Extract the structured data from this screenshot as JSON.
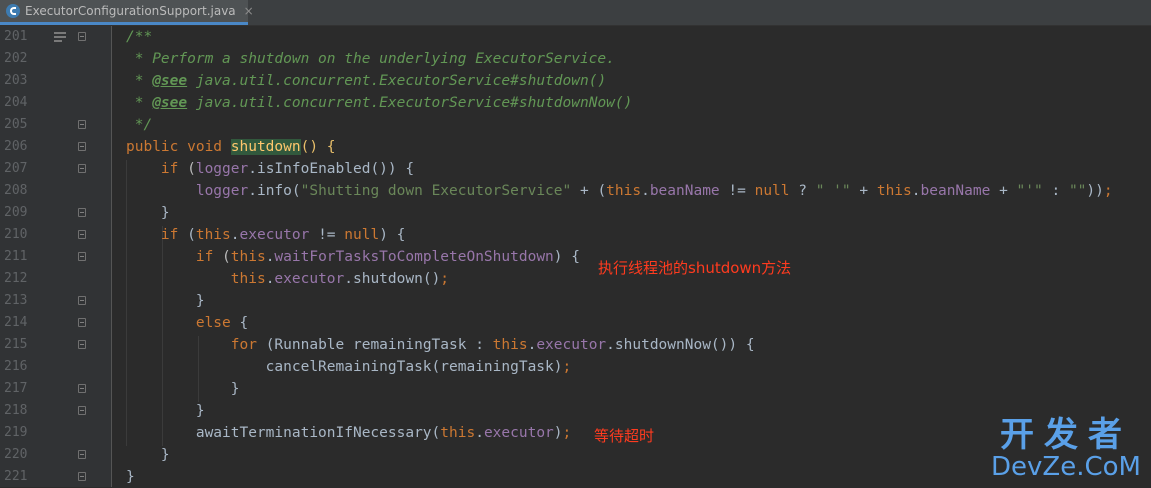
{
  "tab": {
    "filename": "ExecutorConfigurationSupport.java",
    "close_glyph": "×"
  },
  "lines": [
    {
      "n": "201",
      "tokens": [
        {
          "t": "/**",
          "c": "cm"
        }
      ]
    },
    {
      "n": "202",
      "tokens": [
        {
          "t": " * Perform a shutdown on the underlying ExecutorService.",
          "c": "cm"
        }
      ]
    },
    {
      "n": "203",
      "tokens": [
        {
          "t": " * ",
          "c": "cm"
        },
        {
          "t": "@see",
          "c": "tag"
        },
        {
          "t": " java.util.concurrent.ExecutorService",
          "c": "cm"
        },
        {
          "t": "#shutdown()",
          "c": "cm"
        }
      ]
    },
    {
      "n": "204",
      "tokens": [
        {
          "t": " * ",
          "c": "cm"
        },
        {
          "t": "@see",
          "c": "tag"
        },
        {
          "t": " java.util.concurrent.ExecutorService",
          "c": "cm"
        },
        {
          "t": "#shutdownNow()",
          "c": "cm"
        }
      ]
    },
    {
      "n": "205",
      "tokens": [
        {
          "t": " */",
          "c": "cm"
        }
      ]
    },
    {
      "n": "206",
      "tokens": [
        {
          "t": "public void ",
          "c": "kw"
        },
        {
          "t": "shutdown",
          "c": "hl"
        },
        {
          "t": "() {",
          "c": "pr"
        }
      ]
    },
    {
      "n": "207",
      "tokens": [
        {
          "t": "    if ",
          "c": "kw"
        },
        {
          "t": "(",
          "c": "pg"
        },
        {
          "t": "logger",
          "c": "fld"
        },
        {
          "t": ".isInfoEnabled()) {",
          "c": ""
        }
      ]
    },
    {
      "n": "208",
      "tokens": [
        {
          "t": "        ",
          "c": ""
        },
        {
          "t": "logger",
          "c": "fld"
        },
        {
          "t": ".info(",
          "c": ""
        },
        {
          "t": "\"Shutting down ExecutorService\"",
          "c": "str"
        },
        {
          "t": " + (",
          "c": ""
        },
        {
          "t": "this",
          "c": "kw"
        },
        {
          "t": ".",
          "c": ""
        },
        {
          "t": "beanName",
          "c": "fld"
        },
        {
          "t": " != ",
          "c": ""
        },
        {
          "t": "null",
          "c": "kw"
        },
        {
          "t": " ? ",
          "c": ""
        },
        {
          "t": "\" '\"",
          "c": "str"
        },
        {
          "t": " + ",
          "c": ""
        },
        {
          "t": "this",
          "c": "kw"
        },
        {
          "t": ".",
          "c": ""
        },
        {
          "t": "beanName",
          "c": "fld"
        },
        {
          "t": " + ",
          "c": ""
        },
        {
          "t": "\"'\"",
          "c": "str"
        },
        {
          "t": " : ",
          "c": ""
        },
        {
          "t": "\"\"",
          "c": "str"
        },
        {
          "t": "))",
          "c": ""
        },
        {
          "t": ";",
          "c": "kw"
        }
      ]
    },
    {
      "n": "209",
      "tokens": [
        {
          "t": "    }",
          "c": ""
        }
      ]
    },
    {
      "n": "210",
      "tokens": [
        {
          "t": "    if ",
          "c": "kw"
        },
        {
          "t": "(",
          "c": ""
        },
        {
          "t": "this",
          "c": "kw"
        },
        {
          "t": ".",
          "c": ""
        },
        {
          "t": "executor",
          "c": "fld"
        },
        {
          "t": " != ",
          "c": ""
        },
        {
          "t": "null",
          "c": "kw"
        },
        {
          "t": ") {",
          "c": ""
        }
      ]
    },
    {
      "n": "211",
      "tokens": [
        {
          "t": "        if ",
          "c": "kw"
        },
        {
          "t": "(",
          "c": "pg"
        },
        {
          "t": "this",
          "c": "kw"
        },
        {
          "t": ".",
          "c": ""
        },
        {
          "t": "waitForTasksToCompleteOnShutdown",
          "c": "fld"
        },
        {
          "t": ") {",
          "c": ""
        }
      ]
    },
    {
      "n": "212",
      "tokens": [
        {
          "t": "            ",
          "c": ""
        },
        {
          "t": "this",
          "c": "kw"
        },
        {
          "t": ".",
          "c": ""
        },
        {
          "t": "executor",
          "c": "fld"
        },
        {
          "t": ".shutdown()",
          "c": ""
        },
        {
          "t": ";",
          "c": "kw"
        }
      ]
    },
    {
      "n": "213",
      "tokens": [
        {
          "t": "        }",
          "c": ""
        }
      ]
    },
    {
      "n": "214",
      "tokens": [
        {
          "t": "        else ",
          "c": "kw"
        },
        {
          "t": "{",
          "c": ""
        }
      ]
    },
    {
      "n": "215",
      "tokens": [
        {
          "t": "            for ",
          "c": "kw"
        },
        {
          "t": "(Runnable remainingTask : ",
          "c": ""
        },
        {
          "t": "this",
          "c": "kw"
        },
        {
          "t": ".",
          "c": ""
        },
        {
          "t": "executor",
          "c": "fld"
        },
        {
          "t": ".shutdownNow()) {",
          "c": ""
        }
      ]
    },
    {
      "n": "216",
      "tokens": [
        {
          "t": "                cancelRemainingTask(remainingTask)",
          "c": ""
        },
        {
          "t": ";",
          "c": "kw"
        }
      ]
    },
    {
      "n": "217",
      "tokens": [
        {
          "t": "            }",
          "c": ""
        }
      ]
    },
    {
      "n": "218",
      "tokens": [
        {
          "t": "        }",
          "c": ""
        }
      ]
    },
    {
      "n": "219",
      "tokens": [
        {
          "t": "        awaitTerminationIfNecessary(",
          "c": ""
        },
        {
          "t": "this",
          "c": "kw"
        },
        {
          "t": ".",
          "c": ""
        },
        {
          "t": "executor",
          "c": "fld"
        },
        {
          "t": ")",
          "c": ""
        },
        {
          "t": ";",
          "c": "kw"
        }
      ]
    },
    {
      "n": "220",
      "tokens": [
        {
          "t": "    }",
          "c": ""
        }
      ]
    },
    {
      "n": "221",
      "tokens": [
        {
          "t": "}",
          "c": ""
        }
      ]
    }
  ],
  "annotations": {
    "shutdown_note": "执行线程池的shutdown方法",
    "await_note": "等待超时"
  },
  "watermark": {
    "cn": "开发者",
    "en": "DevZe.CoM"
  },
  "colors": {
    "background": "#2b2b2b",
    "keyword": "#cc7832",
    "comment": "#629755",
    "string": "#6a8759",
    "field": "#9876aa",
    "annotation_red": "#ff3b1f",
    "watermark_blue": "#5aa0e8"
  }
}
